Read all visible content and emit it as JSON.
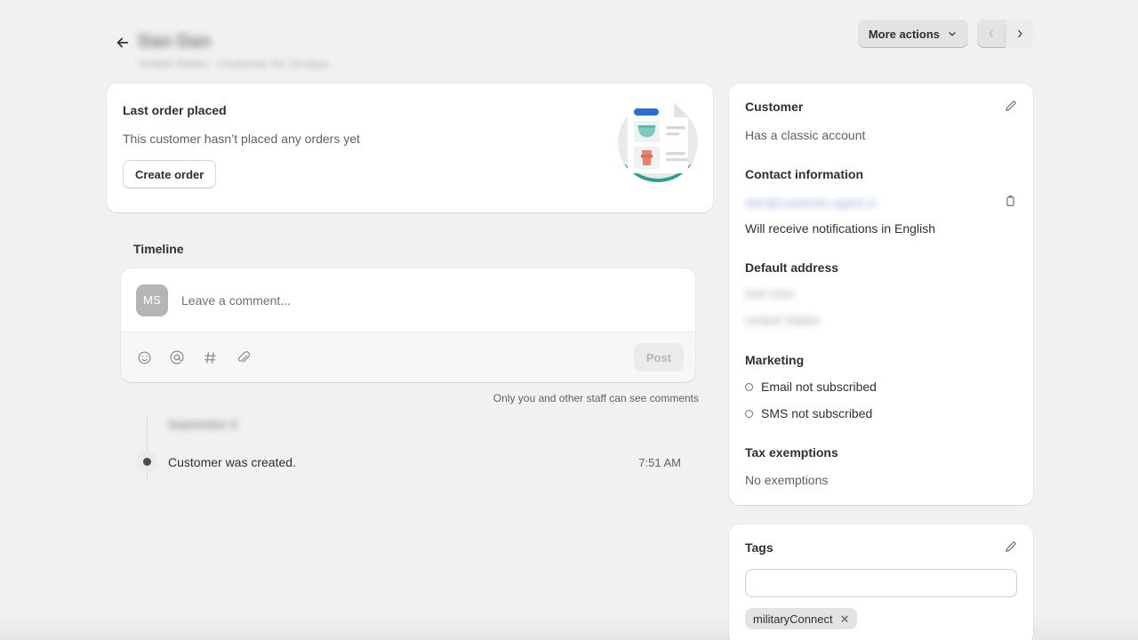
{
  "header": {
    "back_icon": "arrow-left-icon",
    "customer_name": "Dan Dan",
    "customer_meta": "United States · Customer for 16 days",
    "more_actions_label": "More actions",
    "prev_icon": "chevron-left-icon",
    "next_icon": "chevron-right-icon"
  },
  "last_order": {
    "title": "Last order placed",
    "empty_text": "This customer hasn’t placed any orders yet",
    "create_order_label": "Create order",
    "illustration_name": "empty-orders-illustration",
    "illustration_colors": {
      "circle_top": "#e8eaea",
      "circle_bottom": "#2e9e92",
      "paper": "#ffffff",
      "blue_bar": "#2c6ecb",
      "bowl": "#7fc8c0",
      "cup": "#e8806e",
      "line": "#d4d7d9"
    }
  },
  "timeline": {
    "heading": "Timeline",
    "avatar_initials": "MS",
    "comment_placeholder": "Leave a comment...",
    "comment_value": "",
    "tools": [
      {
        "name": "emoji-icon",
        "label": "Insert emoji"
      },
      {
        "name": "mention-icon",
        "label": "Mention someone"
      },
      {
        "name": "hashtag-icon",
        "label": "Insert hashtag"
      },
      {
        "name": "attachment-icon",
        "label": "Attach file"
      }
    ],
    "post_label": "Post",
    "staff_note": "Only you and other staff can see comments",
    "date_label": "September 6",
    "events": [
      {
        "text": "Customer was created.",
        "time": "7:51 AM"
      }
    ]
  },
  "customer_card": {
    "title": "Customer",
    "edit_icon": "pencil-icon",
    "account_status": "Has a classic account",
    "contact_heading": "Contact information",
    "email": "dan@customer.agent.io",
    "copy_icon": "clipboard-icon",
    "notification_language": "Will receive notifications in English",
    "address_heading": "Default address",
    "address_lines": [
      "Dan Dan",
      "United States"
    ],
    "marketing_heading": "Marketing",
    "marketing": [
      "Email not subscribed",
      "SMS not subscribed"
    ],
    "tax_heading": "Tax exemptions",
    "tax_value": "No exemptions"
  },
  "tags_card": {
    "title": "Tags",
    "edit_icon": "pencil-icon",
    "input_value": "",
    "input_placeholder": "",
    "tags": [
      {
        "label": "militaryConnect",
        "remove_icon": "close-icon"
      }
    ]
  },
  "colors": {
    "background": "#f1f1f1",
    "card": "#ffffff",
    "text": "#303030",
    "subdued": "#616161",
    "link": "#3b5bb5",
    "accent_teal": "#2e9e92"
  }
}
